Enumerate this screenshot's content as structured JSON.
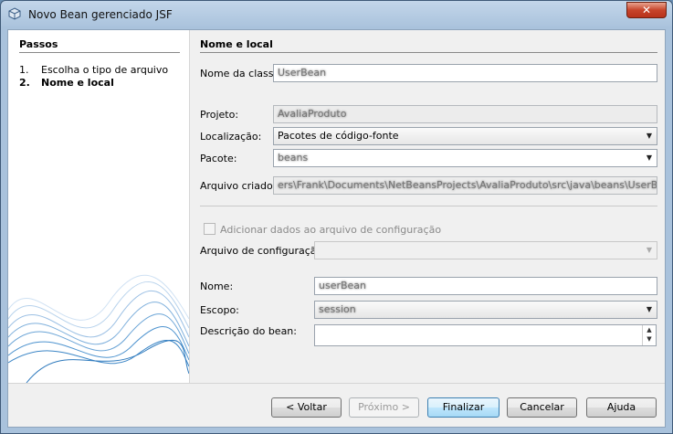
{
  "window": {
    "title": "Novo Bean gerenciado JSF",
    "close_label": "✕"
  },
  "steps": {
    "header": "Passos",
    "items": [
      {
        "num": "1.",
        "label": "Escolha o tipo de arquivo"
      },
      {
        "num": "2.",
        "label": "Nome e local"
      }
    ]
  },
  "form": {
    "header": "Nome e local",
    "class_name": {
      "label": "Nome da classe:",
      "value": "UserBean"
    },
    "project": {
      "label": "Projeto:",
      "value": "AvaliaProduto"
    },
    "location": {
      "label": "Localização:",
      "value": "Pacotes de código-fonte"
    },
    "package": {
      "label": "Pacote:",
      "value": "beans"
    },
    "created_file": {
      "label": "Arquivo criado:",
      "value": "ers\\Frank\\Documents\\NetBeansProjects\\AvaliaProduto\\src\\java\\beans\\UserBean.java"
    },
    "add_config_checkbox": {
      "label": "Adicionar dados ao arquivo de configuração",
      "checked": false
    },
    "config_file": {
      "label": "Arquivo de configuração:",
      "value": ""
    },
    "name": {
      "label": "Nome:",
      "value": "userBean"
    },
    "scope": {
      "label": "Escopo:",
      "value": "session"
    },
    "description": {
      "label": "Descrição do bean:",
      "value": ""
    }
  },
  "buttons": {
    "back": "< Voltar",
    "next": "Próximo >",
    "finish": "Finalizar",
    "cancel": "Cancelar",
    "help": "Ajuda"
  },
  "icons": {
    "app": "netbeans-cube-icon",
    "dropdown": "chevron-down-icon",
    "spinner": "spinner-arrows-icon"
  }
}
